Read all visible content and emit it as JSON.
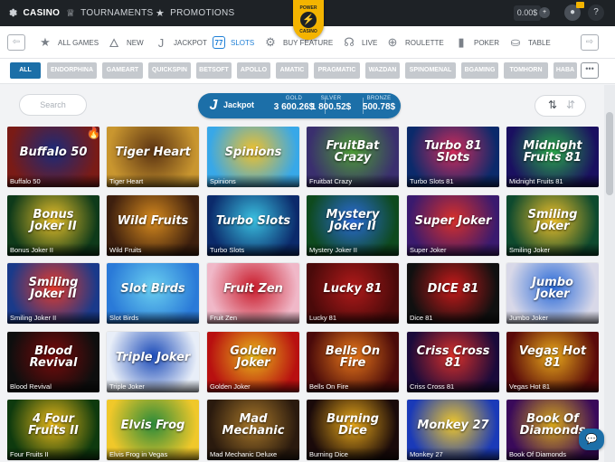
{
  "topnav": {
    "items": [
      {
        "label": "CASINO",
        "icon": "casino-chip-icon"
      },
      {
        "label": "TOURNAMENTS",
        "icon": "trophy-icon"
      },
      {
        "label": "PROMOTIONS",
        "icon": "star-icon"
      }
    ],
    "logo": {
      "line1": "POWER",
      "line2": "CASINO"
    },
    "balance": "0.00$",
    "notification_count": "0",
    "help": "?"
  },
  "categories": [
    {
      "label": "ALL GAMES",
      "icon": "star-icon",
      "glyph": "★"
    },
    {
      "label": "NEW",
      "icon": "flame-icon",
      "glyph": "🜂"
    },
    {
      "label": "JACKPOT",
      "icon": "jackpot-icon",
      "glyph": "J"
    },
    {
      "label": "SLOTS",
      "icon": "slots-seven-icon",
      "glyph": "77"
    },
    {
      "label": "BUY FEATURE",
      "icon": "gear-icon",
      "glyph": "⚙"
    },
    {
      "label": "LIVE",
      "icon": "dealer-icon",
      "glyph": "☊"
    },
    {
      "label": "ROULETTE",
      "icon": "roulette-icon",
      "glyph": "⊕"
    },
    {
      "label": "POKER",
      "icon": "poker-card-icon",
      "glyph": "▮"
    },
    {
      "label": "TABLE",
      "icon": "table-icon",
      "glyph": "⛀"
    }
  ],
  "active_category": "SLOTS",
  "providers": [
    "ALL",
    "ENDORPHINA",
    "GAMEART",
    "QUICKSPIN",
    "BETSOFT",
    "APOLLO",
    "AMATIC",
    "PRAGMATIC",
    "WAZDAN",
    "SPINOMENAL",
    "BGAMING",
    "TOMHORN",
    "HABA"
  ],
  "search": {
    "placeholder": "Search"
  },
  "jackpot": {
    "title": "Jackpot",
    "gold_label": "GOLD",
    "gold_value": "3 600.26$",
    "silver_label": "SILVER",
    "silver_value": "1 800.52$",
    "bronze_label": "BRONZE",
    "bronze_value": "500.78$"
  },
  "games": [
    {
      "name": "Buffalo 50",
      "art": "Buffalo 50",
      "c1": "#7a1b16",
      "c2": "#1a2a7a",
      "hot": true
    },
    {
      "name": "Tiger Heart",
      "art": "Tiger Heart",
      "c1": "#c9962f",
      "c2": "#5b3312"
    },
    {
      "name": "Spinions",
      "art": "Spinions",
      "c1": "#38a8e8",
      "c2": "#f0c02a"
    },
    {
      "name": "Fruitbat Crazy",
      "art": "FruitBat Crazy",
      "c1": "#3a2f6e",
      "c2": "#4d9c35"
    },
    {
      "name": "Turbo Slots 81",
      "art": "Turbo 81 Slots",
      "c1": "#0b2a6b",
      "c2": "#d22b5a"
    },
    {
      "name": "Midnight Fruits 81",
      "art": "Midnight Fruits 81",
      "c1": "#1a1060",
      "c2": "#2aa84a"
    },
    {
      "name": "Bonus Joker II",
      "art": "Bonus Joker II",
      "c1": "#0e3a1a",
      "c2": "#e8c02a"
    },
    {
      "name": "Wild Fruits",
      "art": "Wild Fruits",
      "c1": "#3d1f0e",
      "c2": "#d68a1e"
    },
    {
      "name": "Turbo Slots",
      "art": "Turbo Slots",
      "c1": "#0b2a6b",
      "c2": "#3ac0e0"
    },
    {
      "name": "Mystery Joker II",
      "art": "Mystery Joker II",
      "c1": "#0e4a1e",
      "c2": "#2a6ad8"
    },
    {
      "name": "Super Joker",
      "art": "Super Joker",
      "c1": "#3a1a6e",
      "c2": "#d8302a"
    },
    {
      "name": "Smiling Joker",
      "art": "Smiling Joker",
      "c1": "#0e4a2e",
      "c2": "#f0c02a"
    },
    {
      "name": "Smiling Joker II",
      "art": "Smiling Joker II",
      "c1": "#1a3a8a",
      "c2": "#e83a2a"
    },
    {
      "name": "Slot Birds",
      "art": "Slot Birds",
      "c1": "#2a7ad8",
      "c2": "#6ad0f0"
    },
    {
      "name": "Fruit Zen",
      "art": "Fruit Zen",
      "c1": "#f0b8c8",
      "c2": "#c81a2a"
    },
    {
      "name": "Lucky 81",
      "art": "Lucky 81",
      "c1": "#4a0a0a",
      "c2": "#b01a1a"
    },
    {
      "name": "Dice 81",
      "art": "DICE 81",
      "c1": "#101010",
      "c2": "#c81a1a"
    },
    {
      "name": "Jumbo Joker",
      "art": "Jumbo Joker",
      "c1": "#d8d8e8",
      "c2": "#2a6ad8"
    },
    {
      "name": "Blood Revival",
      "art": "Blood Revival",
      "c1": "#0e0e0e",
      "c2": "#7a0a0a"
    },
    {
      "name": "Triple Joker",
      "art": "Triple Joker",
      "c1": "#e8eef8",
      "c2": "#1a4ab8"
    },
    {
      "name": "Golden Joker",
      "art": "Golden Joker",
      "c1": "#b81010",
      "c2": "#e8b81a"
    },
    {
      "name": "Bells On Fire",
      "art": "Bells On Fire",
      "c1": "#4a0a0a",
      "c2": "#e8781a"
    },
    {
      "name": "Criss Cross 81",
      "art": "Criss Cross 81",
      "c1": "#1a0a3a",
      "c2": "#d8302a"
    },
    {
      "name": "Vegas Hot 81",
      "art": "Vegas Hot 81",
      "c1": "#5a0a0a",
      "c2": "#e8a81a"
    },
    {
      "name": "Four Fruits II",
      "art": "4 Four Fruits II",
      "c1": "#0e3a0e",
      "c2": "#e8b81a"
    },
    {
      "name": "Elvis Frog in Vegas",
      "art": "Elvis Frog",
      "c1": "#f0c82a",
      "c2": "#2a8a3a"
    },
    {
      "name": "Mad Mechanic Deluxe",
      "art": "Mad Mechanic",
      "c1": "#2a1a0e",
      "c2": "#a8782a"
    },
    {
      "name": "Burning Dice",
      "art": "Burning Dice",
      "c1": "#1a0a0a",
      "c2": "#e8a81a"
    },
    {
      "name": "Monkey 27",
      "art": "Monkey 27",
      "c1": "#1a3ab8",
      "c2": "#f0c82a"
    },
    {
      "name": "Book Of Diamonds",
      "art": "Book Of Diamonds",
      "c1": "#3a0a5a",
      "c2": "#d8a81a"
    }
  ]
}
